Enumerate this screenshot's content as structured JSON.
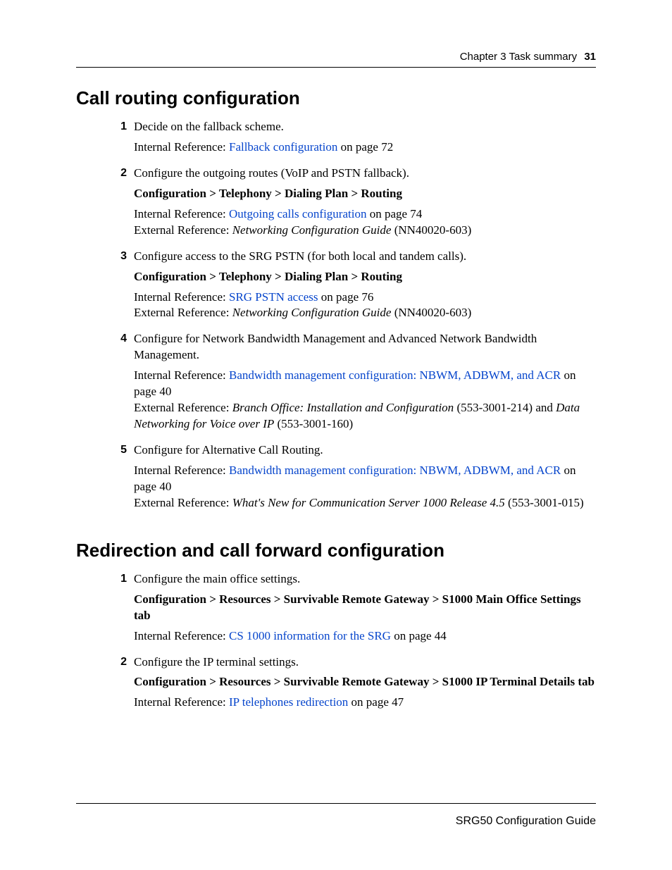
{
  "header": {
    "chapter": "Chapter 3  Task summary",
    "page": "31"
  },
  "sections": [
    {
      "title": "Call routing configuration",
      "items": [
        {
          "num": "1",
          "text": "Decide on the fallback scheme.",
          "int_prefix": "Internal Reference: ",
          "int_link": "Fallback configuration",
          "int_suffix": " on page 72"
        },
        {
          "num": "2",
          "text": "Configure the outgoing routes (VoIP and PSTN fallback).",
          "path": "Configuration > Telephony > Dialing Plan > Routing",
          "int_prefix": "Internal Reference: ",
          "int_link": "Outgoing calls configuration",
          "int_suffix": " on page 74",
          "ext_prefix": "External Reference: ",
          "ext_italic": "Networking Configuration Guide",
          "ext_suffix": " (NN40020-603)"
        },
        {
          "num": "3",
          "text": "Configure access to the SRG PSTN (for both local and tandem calls).",
          "path": "Configuration > Telephony > Dialing Plan > Routing",
          "int_prefix": "Internal Reference: ",
          "int_link": "SRG PSTN access",
          "int_suffix": " on page 76",
          "ext_prefix": "External Reference: ",
          "ext_italic": "Networking Configuration Guide",
          "ext_suffix": " (NN40020-603)"
        },
        {
          "num": "4",
          "text": "Configure for Network Bandwidth Management and Advanced Network Bandwidth Management.",
          "int_prefix": "Internal Reference: ",
          "int_link": "Bandwidth management configuration: NBWM, ADBWM, and ACR",
          "int_suffix": " on page 40",
          "ext_prefix": "External Reference: ",
          "ext_italic": "Branch Office: Installation and Configuration",
          "ext_mid": " (553-3001-214) and ",
          "ext_italic2": "Data Networking for Voice over IP",
          "ext_suffix": " (553-3001-160)"
        },
        {
          "num": "5",
          "text": "Configure for Alternative Call Routing.",
          "int_prefix": "Internal Reference: ",
          "int_link": "Bandwidth management configuration: NBWM, ADBWM, and ACR",
          "int_suffix": " on page 40",
          "ext_prefix": "External Reference: ",
          "ext_italic": "What's New for Communication Server 1000 Release 4.5",
          "ext_suffix": " (553-3001-015)"
        }
      ]
    },
    {
      "title": "Redirection and call forward configuration",
      "items": [
        {
          "num": "1",
          "text": "Configure the main office settings.",
          "path": "Configuration > Resources > Survivable Remote Gateway > S1000 Main Office Settings tab",
          "int_prefix": "Internal Reference: ",
          "int_link": "CS 1000 information for the SRG",
          "int_suffix": " on page 44"
        },
        {
          "num": "2",
          "text": "Configure the IP terminal settings.",
          "path": "Configuration > Resources > Survivable Remote Gateway > S1000 IP Terminal Details tab",
          "int_prefix": "Internal Reference: ",
          "int_link": "IP telephones redirection",
          "int_suffix": " on page 47"
        }
      ]
    }
  ],
  "footer": "SRG50 Configuration Guide"
}
